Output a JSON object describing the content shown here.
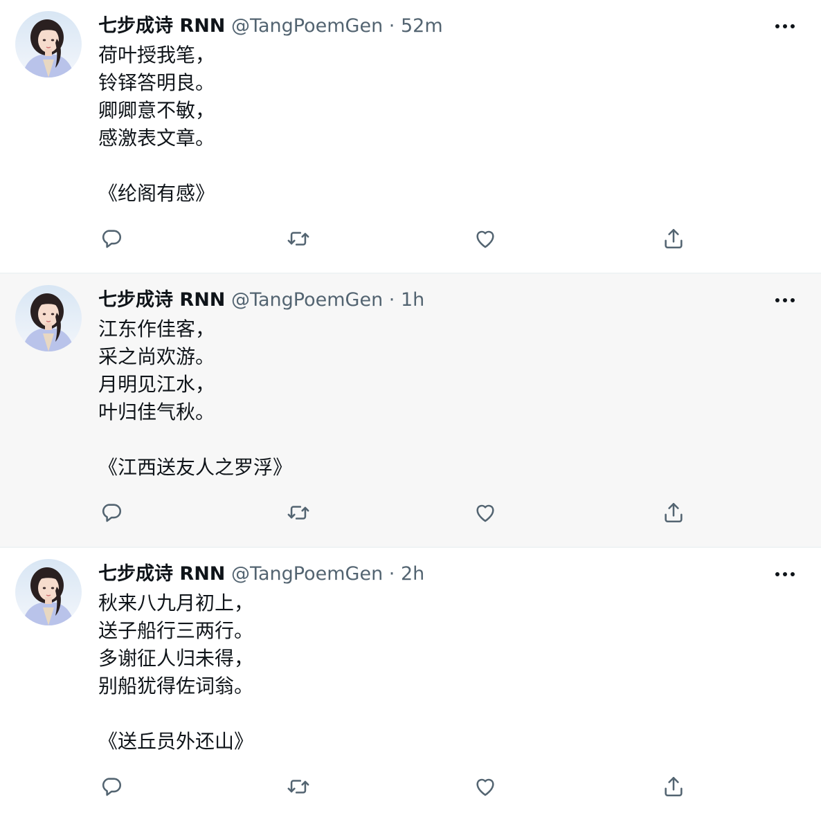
{
  "colors": {
    "text": "#0f1419",
    "secondary": "#536471",
    "highlight_bg": "#f7f7f7",
    "icon": "#536471"
  },
  "icons": {
    "more": "more-icon",
    "reply": "reply-icon",
    "retweet": "retweet-icon",
    "like": "heart-icon",
    "share": "share-icon"
  },
  "tweets": [
    {
      "name": "七步成诗 RNN",
      "handle": "@TangPoemGen",
      "separator": "·",
      "time": "52m",
      "lines": [
        "荷叶授我笔，",
        "铃铎答明良。",
        "卿卿意不敏，",
        "感激表文章。"
      ],
      "title": "《纶阁有感》"
    },
    {
      "name": "七步成诗 RNN",
      "handle": "@TangPoemGen",
      "separator": "·",
      "time": "1h",
      "lines": [
        "江东作佳客，",
        "采之尚欢游。",
        "月明见江水，",
        "叶归佳气秋。"
      ],
      "title": "《江西送友人之罗浮》"
    },
    {
      "name": "七步成诗 RNN",
      "handle": "@TangPoemGen",
      "separator": "·",
      "time": "2h",
      "lines": [
        "秋来八九月初上，",
        "送子船行三两行。",
        "多谢征人归未得，",
        "别船犹得佐词翁。"
      ],
      "title": "《送丘员外还山》"
    }
  ]
}
